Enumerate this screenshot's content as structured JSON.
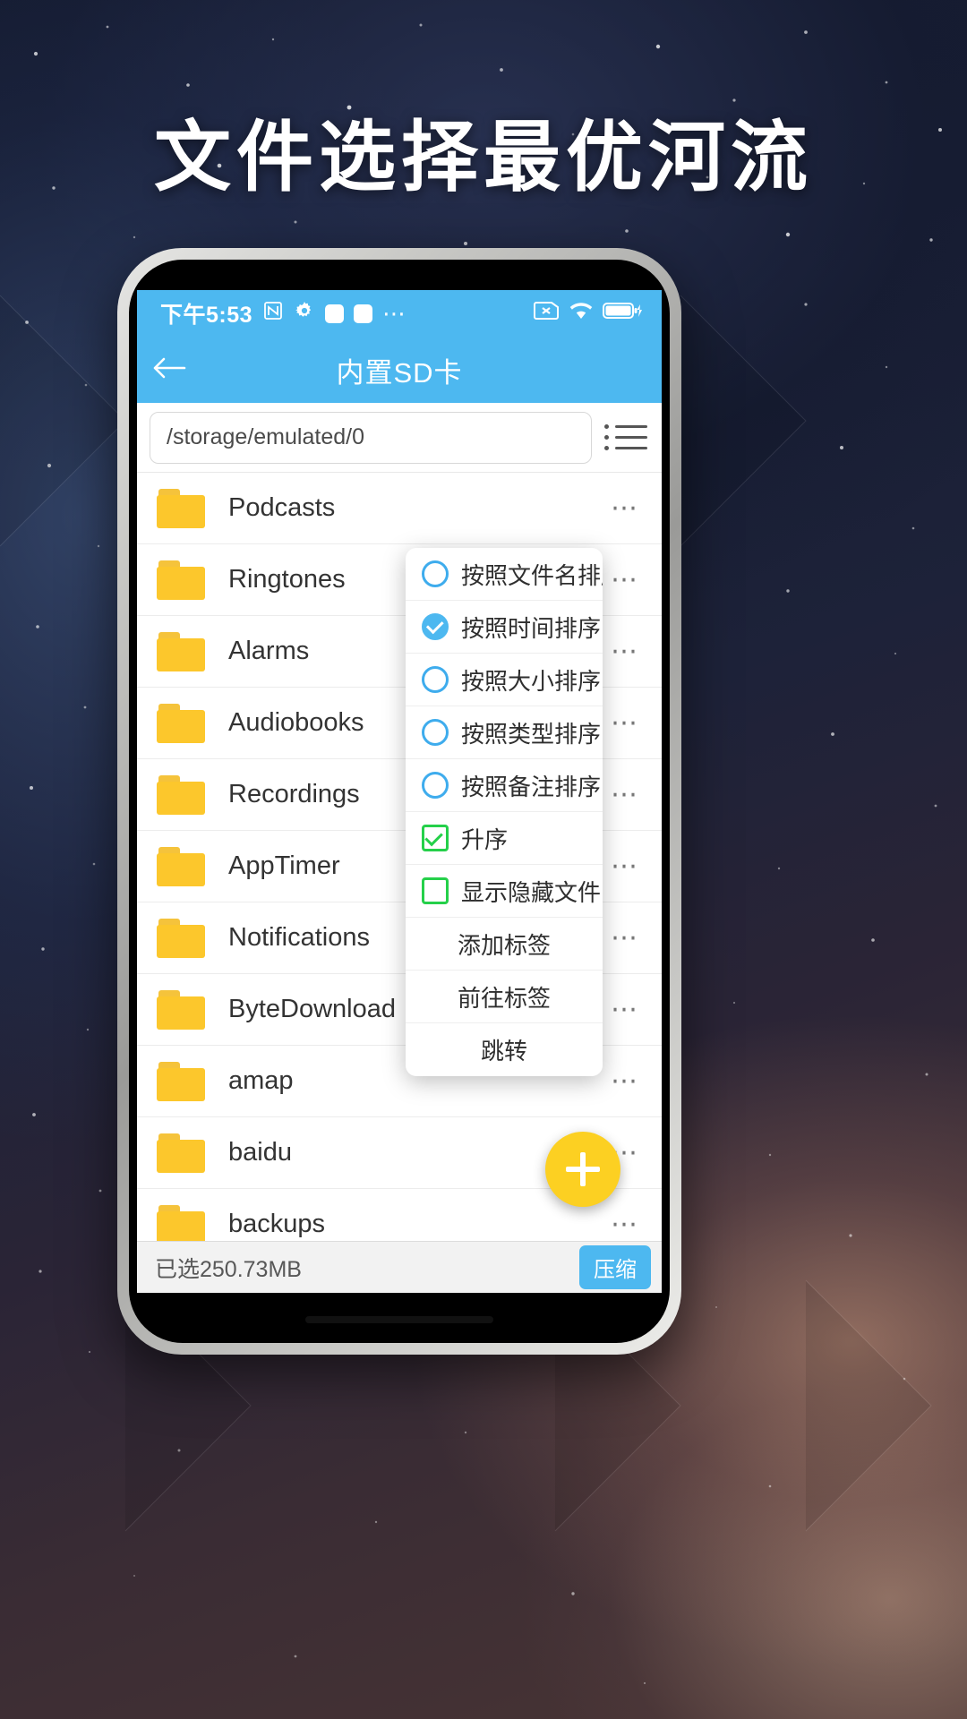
{
  "headline": "文件选择最优河流",
  "statusbar": {
    "time": "下午5:53",
    "icons": [
      "nfc-icon",
      "gear-icon",
      "square-icon",
      "square-rounded-icon",
      "overflow-dots-icon"
    ],
    "right_icons": [
      "sim-x-icon",
      "wifi-icon",
      "battery-charging-icon"
    ]
  },
  "appbar": {
    "back_icon": "back-arrow-icon",
    "title": "内置SD卡"
  },
  "pathbar": {
    "value": "/storage/emulated/0",
    "placeholder": "/storage/emulated/0",
    "toggle_icon": "list-view-icon"
  },
  "files": [
    {
      "name": "Podcasts",
      "icon": "folder-icon",
      "more": "⋯"
    },
    {
      "name": "Ringtones",
      "icon": "folder-icon",
      "more": "⋯"
    },
    {
      "name": "Alarms",
      "icon": "folder-icon",
      "more": "⋯"
    },
    {
      "name": "Audiobooks",
      "icon": "folder-icon",
      "more": "⋯"
    },
    {
      "name": "Recordings",
      "icon": "folder-icon",
      "more": "⋯"
    },
    {
      "name": "AppTimer",
      "icon": "folder-icon",
      "more": "⋯"
    },
    {
      "name": "Notifications",
      "icon": "folder-icon",
      "more": "⋯"
    },
    {
      "name": "ByteDownload",
      "icon": "folder-icon",
      "more": "⋯"
    },
    {
      "name": "amap",
      "icon": "folder-icon",
      "more": "⋯"
    },
    {
      "name": "baidu",
      "icon": "folder-icon",
      "more": "⋯"
    },
    {
      "name": "backups",
      "icon": "folder-icon",
      "more": "⋯"
    }
  ],
  "menu": {
    "items": [
      {
        "label": "按照文件名排序",
        "control": "radio",
        "checked": false
      },
      {
        "label": "按照时间排序",
        "control": "radio",
        "checked": true
      },
      {
        "label": "按照大小排序",
        "control": "radio",
        "checked": false
      },
      {
        "label": "按照类型排序",
        "control": "radio",
        "checked": false
      },
      {
        "label": "按照备注排序",
        "control": "radio",
        "checked": false
      },
      {
        "label": "升序",
        "control": "checkbox",
        "checked": true
      },
      {
        "label": "显示隐藏文件",
        "control": "checkbox",
        "checked": false
      },
      {
        "label": "添加标签",
        "control": "none",
        "checked": false
      },
      {
        "label": "前往标签",
        "control": "none",
        "checked": false
      },
      {
        "label": "跳转",
        "control": "none",
        "checked": false
      }
    ]
  },
  "fab": {
    "icon": "plus-icon"
  },
  "bottombar": {
    "selected_size": "已选250.73MB",
    "compress_label": "压缩"
  },
  "colors": {
    "accent": "#4db8f0",
    "folder": "#fcc72c",
    "fab": "#fcd022",
    "check_green": "#25d04a"
  }
}
